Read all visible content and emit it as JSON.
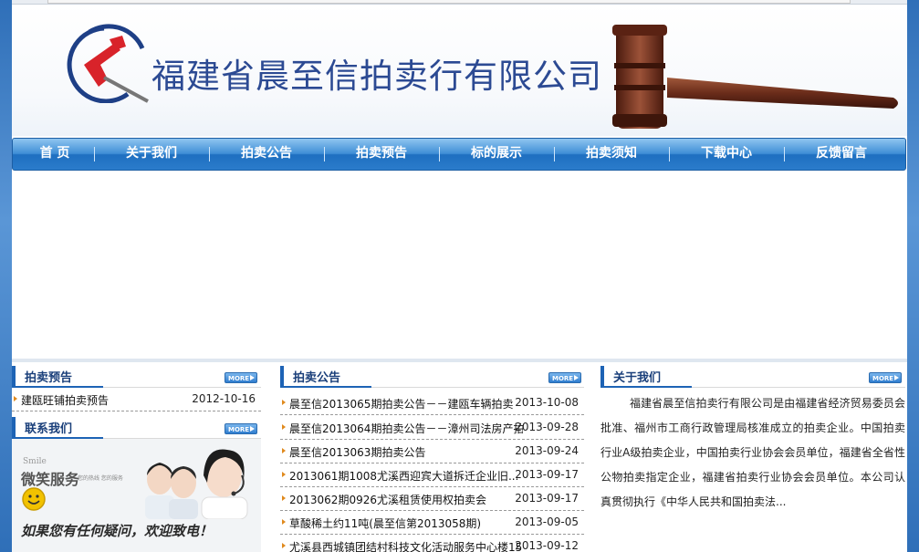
{
  "header": {
    "company_name": "福建省晨至信拍卖行有限公司"
  },
  "nav": {
    "items": [
      {
        "label": "首 页"
      },
      {
        "label": "关于我们"
      },
      {
        "label": "拍卖公告"
      },
      {
        "label": "拍卖预告"
      },
      {
        "label": "标的展示"
      },
      {
        "label": "拍卖须知"
      },
      {
        "label": "下载中心"
      },
      {
        "label": "反馈留言"
      }
    ]
  },
  "preview_panel": {
    "title": "拍卖预告",
    "more": "MORE",
    "items": [
      {
        "title": "建瓯旺铺拍卖预告",
        "date": "2012-10-16"
      }
    ]
  },
  "contact_panel": {
    "title": "联系我们",
    "more": "MORE",
    "smile_en": "Smile",
    "smile_cn": "微笑服务",
    "smile_sub": "您的热线  您的服务",
    "message": "如果您有任何疑问，欢迎致电！"
  },
  "announce_panel": {
    "title": "拍卖公告",
    "more": "MORE",
    "items": [
      {
        "title": "晨至信2013065期拍卖公告－－建瓯车辆拍卖",
        "date": "2013-10-08"
      },
      {
        "title": "晨至信2013064期拍卖公告－－漳州司法房产拍...",
        "date": "2013-09-28"
      },
      {
        "title": "晨至信2013063期拍卖公告",
        "date": "2013-09-24"
      },
      {
        "title": "2013061期1008尤溪西迎宾大道拆迁企业旧...",
        "date": "2013-09-17"
      },
      {
        "title": "2013062期0926尤溪租赁使用权拍卖会",
        "date": "2013-09-17"
      },
      {
        "title": "草酸稀土约11吨(晨至信第2013058期)",
        "date": "2013-09-05"
      },
      {
        "title": "尤溪县西城镇团结村科技文化活动服务中心楼15",
        "date": "2013-09-12"
      }
    ]
  },
  "about_panel": {
    "title": "关于我们",
    "more": "MORE",
    "text": "福建省晨至信拍卖行有限公司是由福建省经济贸易委员会批准、福州市工商行政管理局核准成立的拍卖企业。中国拍卖行业A级拍卖企业，中国拍卖行业协会会员单位，福建省全省性公物拍卖指定企业，福建省拍卖行业协会会员单位。本公司认真贯彻执行《中华人民共和国拍卖法..."
  },
  "colors": {
    "nav_blue": "#2b7ccb",
    "title_blue": "#1d63b5",
    "company_text": "#2c4a93",
    "bullet_orange": "#e08a1e"
  }
}
